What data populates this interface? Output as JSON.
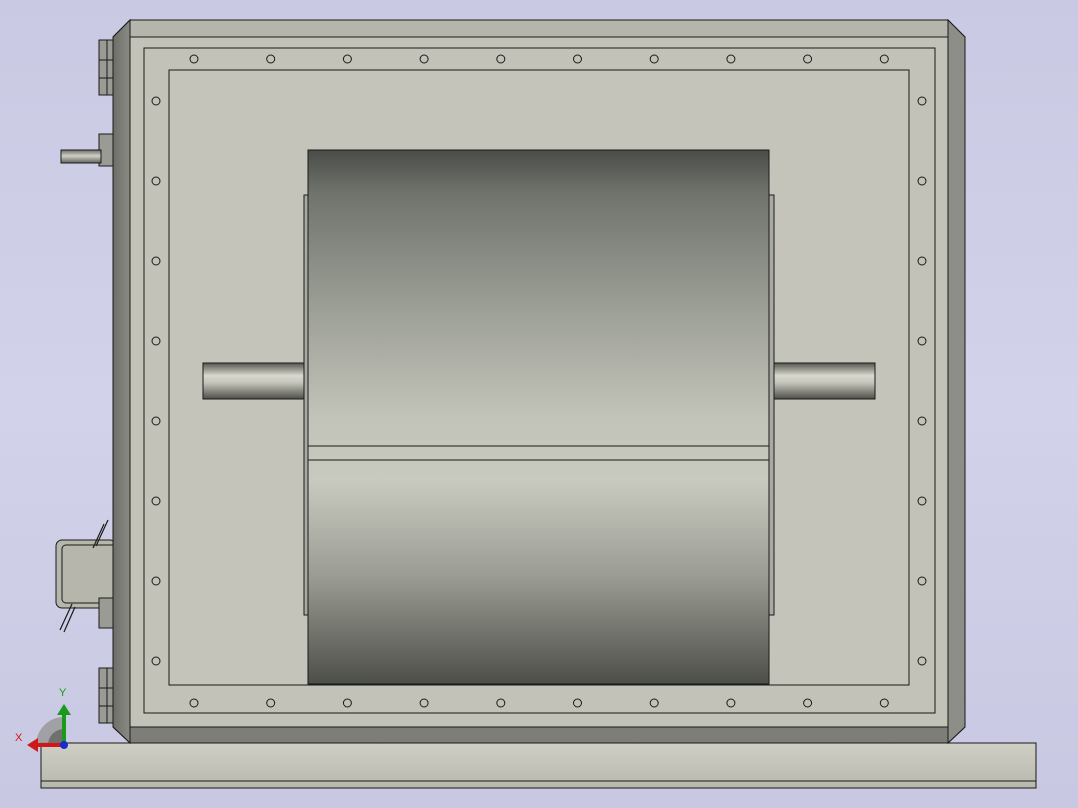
{
  "view": {
    "background_top": "#c9c9e3",
    "background_bottom": "#c8c8e2",
    "model_face_color": "#c2c2b8",
    "model_edge_color": "#1a1a1a"
  },
  "triad": {
    "x_label": "X",
    "y_label": "Y",
    "x_color": "#d01818",
    "y_color": "#1a9a1a",
    "z_color": "#1a2ad0"
  }
}
